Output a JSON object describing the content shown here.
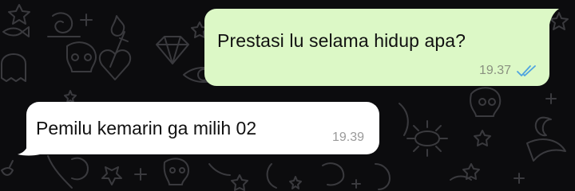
{
  "chat": {
    "messages": [
      {
        "direction": "outgoing",
        "text": "Prestasi lu selama hidup apa?",
        "time": "19.37",
        "status_icon": "double-check-read-icon"
      },
      {
        "direction": "incoming",
        "text": "Pemilu kemarin ga milih 02",
        "time": "19.39"
      }
    ]
  },
  "colors": {
    "background": "#0c0c0e",
    "doodle_stroke": "#3a3a3e",
    "outgoing_bubble": "#dcf8c6",
    "incoming_bubble": "#ffffff",
    "read_tick": "#4fa3e0",
    "timestamp": "#8a9180"
  }
}
